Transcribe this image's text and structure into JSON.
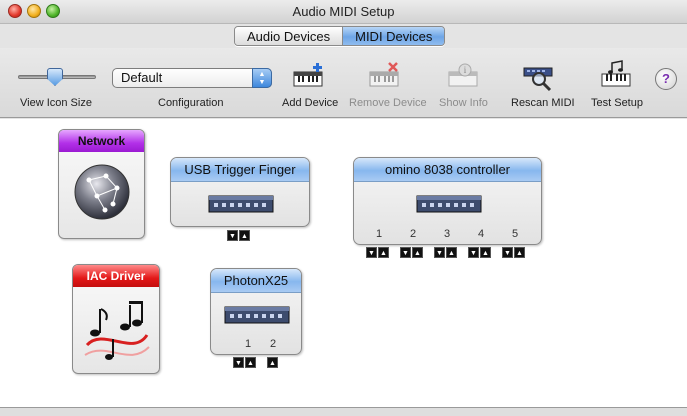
{
  "window": {
    "title": "Audio MIDI Setup"
  },
  "tabs": [
    {
      "label": "Audio Devices",
      "active": false
    },
    {
      "label": "MIDI Devices",
      "active": true
    }
  ],
  "toolbar": {
    "view_icon_size_label": "View Icon Size",
    "view_icon_size_level": 0.45,
    "configuration_label": "Configuration",
    "configuration_value": "Default",
    "add_device_label": "Add Device",
    "remove_device_label": "Remove Device",
    "show_info_label": "Show Info",
    "rescan_midi_label": "Rescan MIDI",
    "test_setup_label": "Test Setup",
    "help_glyph": "?"
  },
  "devices": {
    "network": {
      "label": "Network",
      "color": "#b230e8"
    },
    "iac": {
      "label": "IAC Driver",
      "color": "#e31818"
    },
    "usb_trigger": {
      "label": "USB Trigger Finger"
    },
    "omino": {
      "label": "omino 8038 controller",
      "ports": [
        "1",
        "2",
        "3",
        "4",
        "5"
      ]
    },
    "photon": {
      "label": "PhotonX25",
      "ports": [
        "1",
        "2"
      ]
    }
  },
  "icons": {
    "down_arrow": "▼",
    "up_arrow": "▲",
    "popup_arrows": "▲▼"
  },
  "colors": {
    "accent": "#6ea5e6",
    "device_header": "#87b7ee"
  }
}
